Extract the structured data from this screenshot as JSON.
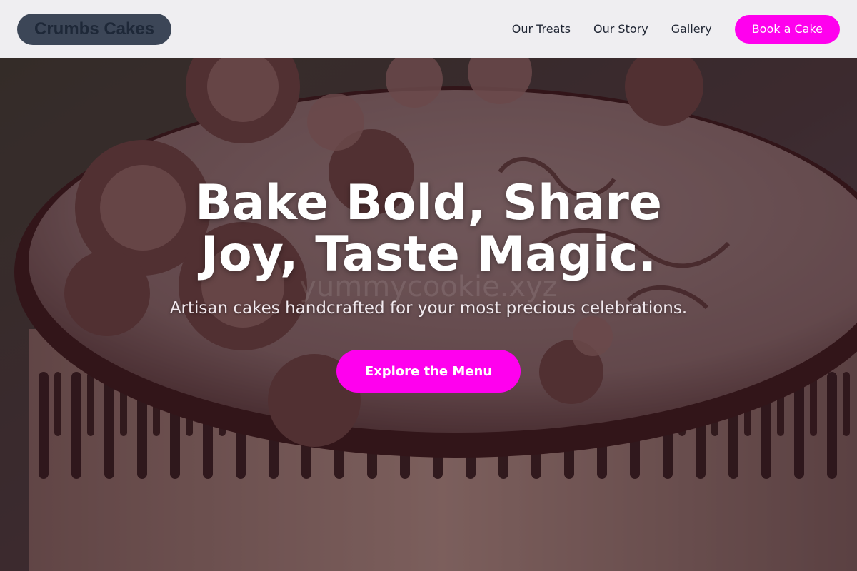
{
  "header": {
    "logo": "Crumbs Cakes",
    "nav": [
      {
        "label": "Our Treats"
      },
      {
        "label": "Our Story"
      },
      {
        "label": "Gallery"
      }
    ],
    "cta_label": "Book a Cake"
  },
  "hero": {
    "title": "Bake Bold, Share Joy, Taste Magic.",
    "watermark": "yummycookie.xyz",
    "subtitle": "Artisan cakes handcrafted for your most precious celebrations.",
    "cta_label": "Explore the Menu"
  },
  "colors": {
    "accent": "#ff00ee",
    "header_bg": "#efeef1",
    "logo_bg": "#3c4657",
    "nav_text": "#1f2533"
  }
}
